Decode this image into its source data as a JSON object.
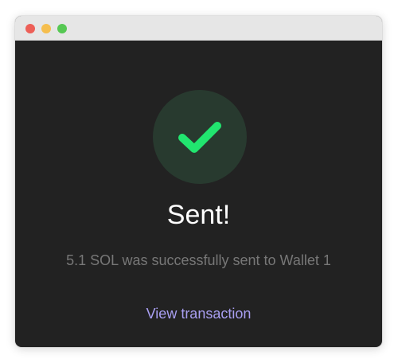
{
  "window": {
    "controls": [
      {
        "name": "close",
        "color": "#ed5f57"
      },
      {
        "name": "minimize",
        "color": "#f5be4e"
      },
      {
        "name": "zoom",
        "color": "#56c853"
      }
    ]
  },
  "status": {
    "icon": "checkmark-icon",
    "circle_color": "#283a2f",
    "check_color": "#21e56f",
    "title": "Sent!",
    "message": "5.1 SOL was successfully sent to Wallet 1"
  },
  "actions": {
    "view_transaction_label": "View transaction",
    "link_color": "#a99ff2"
  }
}
